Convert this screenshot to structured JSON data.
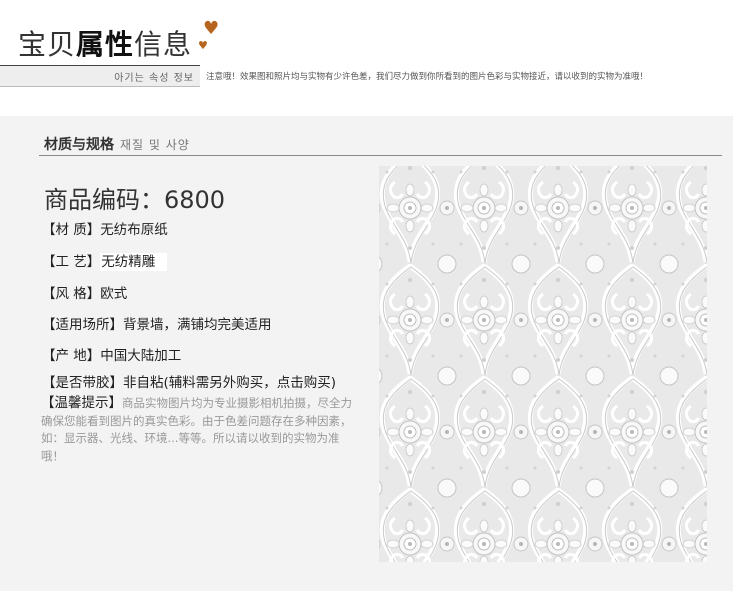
{
  "header": {
    "title_part1": "宝贝",
    "title_part2": "属性",
    "title_part3": "信息",
    "subtitle": "아기는 속성 정보",
    "notice": "注意哦！效果图和照片均与实物有少许色差，我们尽力做到你所看到的图片色彩与实物接近，请以收到的实物为准哦！",
    "heart_icon": "heart-icon"
  },
  "section": {
    "title": "材质与规格",
    "subtitle": "재질 및 사양"
  },
  "product": {
    "code": "商品编码：6800",
    "specs": [
      {
        "label": "【材  质】",
        "value": "无纺布原纸"
      },
      {
        "label": "【工  艺】",
        "value": "无纺精雕"
      },
      {
        "label": "【风  格】",
        "value": "欧式"
      },
      {
        "label": "【适用场所】",
        "value": "背景墙，满铺均完美适用"
      },
      {
        "label": "【产  地】",
        "value": "中国大陆加工"
      },
      {
        "label": "【是否带胶】",
        "value": "非自粘(辅料需另外购买，点击购买)"
      }
    ],
    "tip_label": "【温馨提示】",
    "tip_text": "商品实物图片均为专业摄影相机拍摄，尽全力确保您能看到图片的真实色彩。由于色差问题存在多种因素，如：显示器、光线、环境...等等。所以请以收到的实物为准哦！"
  },
  "colors": {
    "accent_heart": "#b5651d",
    "panel_bg": "#f3f3f3",
    "sample_bg": "#ebebeb"
  }
}
